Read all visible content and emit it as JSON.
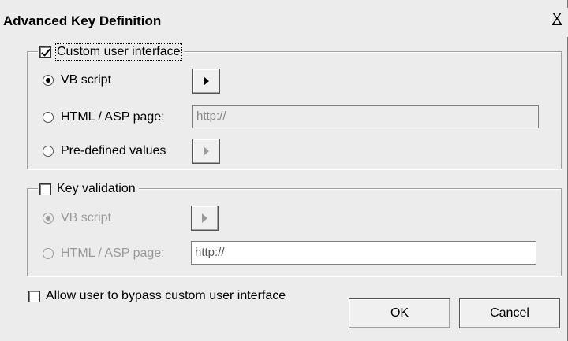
{
  "dialog": {
    "title": "Advanced Key Definition",
    "close_glyph": "X"
  },
  "custom_ui": {
    "label": "Custom user interface",
    "checked": true,
    "vb_script_label": "VB script",
    "html_asp_label": "HTML / ASP page:",
    "html_asp_value": "http://",
    "predefined_label": "Pre-defined values",
    "selected": "VB script"
  },
  "key_validation": {
    "label": "Key validation",
    "checked": false,
    "vb_script_label": "VB script",
    "html_asp_label": "HTML / ASP page:",
    "html_asp_value": "http://",
    "selected": "VB script"
  },
  "bypass": {
    "label": "Allow user to bypass custom user interface",
    "checked": false
  },
  "buttons": {
    "ok": "OK",
    "cancel": "Cancel"
  }
}
